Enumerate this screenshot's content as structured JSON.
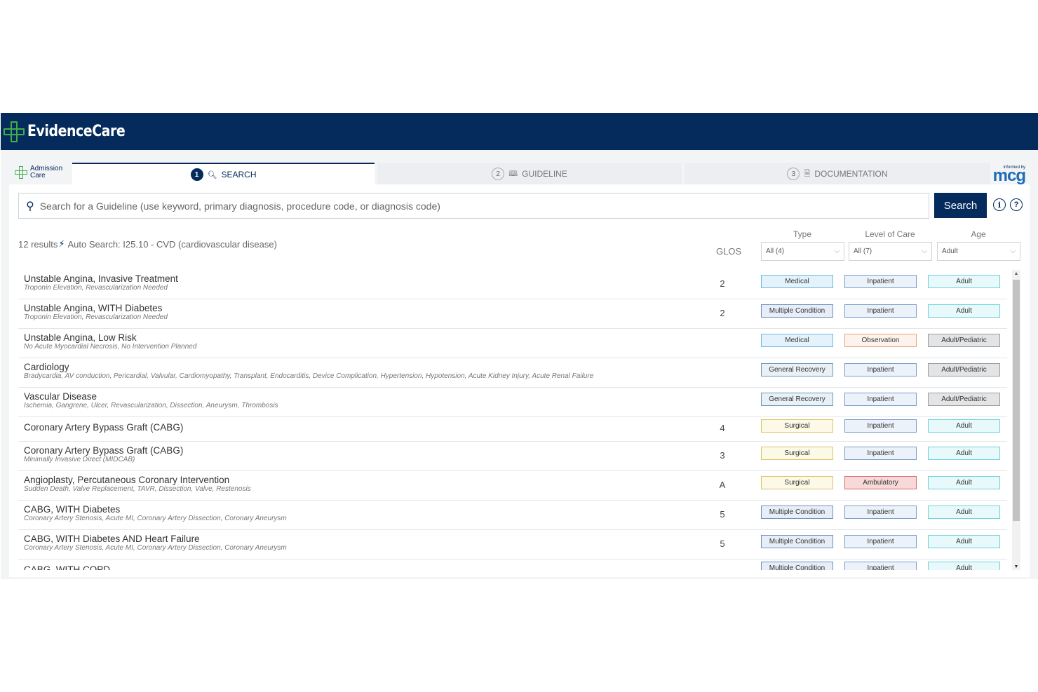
{
  "app": {
    "brand": "EvidenceCare"
  },
  "admission": {
    "line1": "Admission",
    "line2": "Care"
  },
  "tabs": [
    {
      "num": "1",
      "label": "SEARCH",
      "icon": "search-icon"
    },
    {
      "num": "2",
      "label": "GUIDELINE",
      "icon": "book-icon"
    },
    {
      "num": "3",
      "label": "DOCUMENTATION",
      "icon": "document-icon"
    }
  ],
  "partner": {
    "small": "informed by",
    "big": "mcg"
  },
  "search": {
    "placeholder": "Search for a Guideline (use keyword, primary diagnosis, procedure code, or diagnosis code)",
    "button": "Search"
  },
  "summary": {
    "count": "12 results",
    "auto": "Auto Search: I25.10 - CVD (cardiovascular disease)"
  },
  "columns": {
    "glos": "GLOS"
  },
  "filters": [
    {
      "label": "Type",
      "value": "All (4)"
    },
    {
      "label": "Level of Care",
      "value": "All (7)"
    },
    {
      "label": "Age",
      "value": "Adult"
    }
  ],
  "results": [
    {
      "title": "Unstable Angina, Invasive Treatment",
      "sub": "Troponin Elevation, Revascularization Needed",
      "glos": "2",
      "type": "Medical",
      "loc": "Inpatient",
      "age": "Adult"
    },
    {
      "title": "Unstable Angina, WITH Diabetes",
      "sub": "Troponin Elevation, Revascularization Needed",
      "glos": "2",
      "type": "Multiple Condition",
      "loc": "Inpatient",
      "age": "Adult"
    },
    {
      "title": "Unstable Angina, Low Risk",
      "sub": "No Acute Myocardial Necrosis, No Intervention Planned",
      "glos": "",
      "type": "Medical",
      "loc": "Observation",
      "age": "Adult/Pediatric"
    },
    {
      "title": "Cardiology",
      "sub": "Bradycardia, AV conduction, Pericardial, Valvular, Cardiomyopathy, Transplant, Endocarditis, Device Complication, Hypertension, Hypotension, Acute Kidney Injury, Acute Renal Failure",
      "glos": "",
      "type": "General Recovery",
      "loc": "Inpatient",
      "age": "Adult/Pediatric"
    },
    {
      "title": "Vascular Disease",
      "sub": "Ischemia, Gangrene, Ulcer, Revascularization, Dissection, Aneurysm, Thrombosis",
      "glos": "",
      "type": "General Recovery",
      "loc": "Inpatient",
      "age": "Adult/Pediatric"
    },
    {
      "title": "Coronary Artery Bypass Graft (CABG)",
      "sub": "",
      "glos": "4",
      "type": "Surgical",
      "loc": "Inpatient",
      "age": "Adult"
    },
    {
      "title": "Coronary Artery Bypass Graft (CABG)",
      "sub": "Minimally Invasive Direct (MIDCAB)",
      "glos": "3",
      "type": "Surgical",
      "loc": "Inpatient",
      "age": "Adult"
    },
    {
      "title": "Angioplasty, Percutaneous Coronary Intervention",
      "sub": "Sudden Death, Valve Replacement, TAVR, Dissection, Valve, Restenosis",
      "glos": "A",
      "type": "Surgical",
      "loc": "Ambulatory",
      "age": "Adult"
    },
    {
      "title": "CABG, WITH Diabetes",
      "sub": "Coronary Artery Stenosis, Acute MI, Coronary Artery Dissection, Coronary Aneurysm",
      "glos": "5",
      "type": "Multiple Condition",
      "loc": "Inpatient",
      "age": "Adult"
    },
    {
      "title": "CABG, WITH Diabetes AND Heart Failure",
      "sub": "Coronary Artery Stenosis, Acute MI, Coronary Artery Dissection, Coronary Aneurysm",
      "glos": "5",
      "type": "Multiple Condition",
      "loc": "Inpatient",
      "age": "Adult"
    },
    {
      "title": "CABG, WITH COPD",
      "sub": "",
      "glos": "",
      "type": "Multiple Condition",
      "loc": "Inpatient",
      "age": "Adult"
    }
  ]
}
